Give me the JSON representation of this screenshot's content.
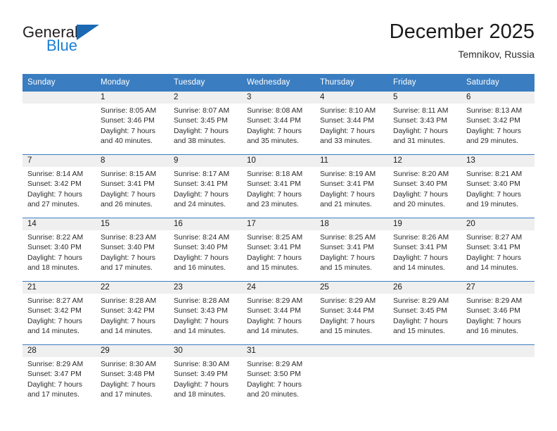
{
  "brand": {
    "name_top": "General",
    "name_bottom": "Blue",
    "triangle_color": "#1b68b3",
    "blue_text_color": "#1b7fd4"
  },
  "header": {
    "title": "December 2025",
    "subtitle": "Temnikov, Russia"
  },
  "colors": {
    "header_blue": "#3a7dc0",
    "daynum_band": "#efefef",
    "text": "#2b2b2b"
  },
  "weekdays": [
    "Sunday",
    "Monday",
    "Tuesday",
    "Wednesday",
    "Thursday",
    "Friday",
    "Saturday"
  ],
  "weeks": [
    [
      {
        "day": "",
        "sunrise": "",
        "sunset": "",
        "daylight1": "",
        "daylight2": ""
      },
      {
        "day": "1",
        "sunrise": "Sunrise: 8:05 AM",
        "sunset": "Sunset: 3:46 PM",
        "daylight1": "Daylight: 7 hours",
        "daylight2": "and 40 minutes."
      },
      {
        "day": "2",
        "sunrise": "Sunrise: 8:07 AM",
        "sunset": "Sunset: 3:45 PM",
        "daylight1": "Daylight: 7 hours",
        "daylight2": "and 38 minutes."
      },
      {
        "day": "3",
        "sunrise": "Sunrise: 8:08 AM",
        "sunset": "Sunset: 3:44 PM",
        "daylight1": "Daylight: 7 hours",
        "daylight2": "and 35 minutes."
      },
      {
        "day": "4",
        "sunrise": "Sunrise: 8:10 AM",
        "sunset": "Sunset: 3:44 PM",
        "daylight1": "Daylight: 7 hours",
        "daylight2": "and 33 minutes."
      },
      {
        "day": "5",
        "sunrise": "Sunrise: 8:11 AM",
        "sunset": "Sunset: 3:43 PM",
        "daylight1": "Daylight: 7 hours",
        "daylight2": "and 31 minutes."
      },
      {
        "day": "6",
        "sunrise": "Sunrise: 8:13 AM",
        "sunset": "Sunset: 3:42 PM",
        "daylight1": "Daylight: 7 hours",
        "daylight2": "and 29 minutes."
      }
    ],
    [
      {
        "day": "7",
        "sunrise": "Sunrise: 8:14 AM",
        "sunset": "Sunset: 3:42 PM",
        "daylight1": "Daylight: 7 hours",
        "daylight2": "and 27 minutes."
      },
      {
        "day": "8",
        "sunrise": "Sunrise: 8:15 AM",
        "sunset": "Sunset: 3:41 PM",
        "daylight1": "Daylight: 7 hours",
        "daylight2": "and 26 minutes."
      },
      {
        "day": "9",
        "sunrise": "Sunrise: 8:17 AM",
        "sunset": "Sunset: 3:41 PM",
        "daylight1": "Daylight: 7 hours",
        "daylight2": "and 24 minutes."
      },
      {
        "day": "10",
        "sunrise": "Sunrise: 8:18 AM",
        "sunset": "Sunset: 3:41 PM",
        "daylight1": "Daylight: 7 hours",
        "daylight2": "and 23 minutes."
      },
      {
        "day": "11",
        "sunrise": "Sunrise: 8:19 AM",
        "sunset": "Sunset: 3:41 PM",
        "daylight1": "Daylight: 7 hours",
        "daylight2": "and 21 minutes."
      },
      {
        "day": "12",
        "sunrise": "Sunrise: 8:20 AM",
        "sunset": "Sunset: 3:40 PM",
        "daylight1": "Daylight: 7 hours",
        "daylight2": "and 20 minutes."
      },
      {
        "day": "13",
        "sunrise": "Sunrise: 8:21 AM",
        "sunset": "Sunset: 3:40 PM",
        "daylight1": "Daylight: 7 hours",
        "daylight2": "and 19 minutes."
      }
    ],
    [
      {
        "day": "14",
        "sunrise": "Sunrise: 8:22 AM",
        "sunset": "Sunset: 3:40 PM",
        "daylight1": "Daylight: 7 hours",
        "daylight2": "and 18 minutes."
      },
      {
        "day": "15",
        "sunrise": "Sunrise: 8:23 AM",
        "sunset": "Sunset: 3:40 PM",
        "daylight1": "Daylight: 7 hours",
        "daylight2": "and 17 minutes."
      },
      {
        "day": "16",
        "sunrise": "Sunrise: 8:24 AM",
        "sunset": "Sunset: 3:40 PM",
        "daylight1": "Daylight: 7 hours",
        "daylight2": "and 16 minutes."
      },
      {
        "day": "17",
        "sunrise": "Sunrise: 8:25 AM",
        "sunset": "Sunset: 3:41 PM",
        "daylight1": "Daylight: 7 hours",
        "daylight2": "and 15 minutes."
      },
      {
        "day": "18",
        "sunrise": "Sunrise: 8:25 AM",
        "sunset": "Sunset: 3:41 PM",
        "daylight1": "Daylight: 7 hours",
        "daylight2": "and 15 minutes."
      },
      {
        "day": "19",
        "sunrise": "Sunrise: 8:26 AM",
        "sunset": "Sunset: 3:41 PM",
        "daylight1": "Daylight: 7 hours",
        "daylight2": "and 14 minutes."
      },
      {
        "day": "20",
        "sunrise": "Sunrise: 8:27 AM",
        "sunset": "Sunset: 3:41 PM",
        "daylight1": "Daylight: 7 hours",
        "daylight2": "and 14 minutes."
      }
    ],
    [
      {
        "day": "21",
        "sunrise": "Sunrise: 8:27 AM",
        "sunset": "Sunset: 3:42 PM",
        "daylight1": "Daylight: 7 hours",
        "daylight2": "and 14 minutes."
      },
      {
        "day": "22",
        "sunrise": "Sunrise: 8:28 AM",
        "sunset": "Sunset: 3:42 PM",
        "daylight1": "Daylight: 7 hours",
        "daylight2": "and 14 minutes."
      },
      {
        "day": "23",
        "sunrise": "Sunrise: 8:28 AM",
        "sunset": "Sunset: 3:43 PM",
        "daylight1": "Daylight: 7 hours",
        "daylight2": "and 14 minutes."
      },
      {
        "day": "24",
        "sunrise": "Sunrise: 8:29 AM",
        "sunset": "Sunset: 3:44 PM",
        "daylight1": "Daylight: 7 hours",
        "daylight2": "and 14 minutes."
      },
      {
        "day": "25",
        "sunrise": "Sunrise: 8:29 AM",
        "sunset": "Sunset: 3:44 PM",
        "daylight1": "Daylight: 7 hours",
        "daylight2": "and 15 minutes."
      },
      {
        "day": "26",
        "sunrise": "Sunrise: 8:29 AM",
        "sunset": "Sunset: 3:45 PM",
        "daylight1": "Daylight: 7 hours",
        "daylight2": "and 15 minutes."
      },
      {
        "day": "27",
        "sunrise": "Sunrise: 8:29 AM",
        "sunset": "Sunset: 3:46 PM",
        "daylight1": "Daylight: 7 hours",
        "daylight2": "and 16 minutes."
      }
    ],
    [
      {
        "day": "28",
        "sunrise": "Sunrise: 8:29 AM",
        "sunset": "Sunset: 3:47 PM",
        "daylight1": "Daylight: 7 hours",
        "daylight2": "and 17 minutes."
      },
      {
        "day": "29",
        "sunrise": "Sunrise: 8:30 AM",
        "sunset": "Sunset: 3:48 PM",
        "daylight1": "Daylight: 7 hours",
        "daylight2": "and 17 minutes."
      },
      {
        "day": "30",
        "sunrise": "Sunrise: 8:30 AM",
        "sunset": "Sunset: 3:49 PM",
        "daylight1": "Daylight: 7 hours",
        "daylight2": "and 18 minutes."
      },
      {
        "day": "31",
        "sunrise": "Sunrise: 8:29 AM",
        "sunset": "Sunset: 3:50 PM",
        "daylight1": "Daylight: 7 hours",
        "daylight2": "and 20 minutes."
      },
      {
        "day": "",
        "sunrise": "",
        "sunset": "",
        "daylight1": "",
        "daylight2": ""
      },
      {
        "day": "",
        "sunrise": "",
        "sunset": "",
        "daylight1": "",
        "daylight2": ""
      },
      {
        "day": "",
        "sunrise": "",
        "sunset": "",
        "daylight1": "",
        "daylight2": ""
      }
    ]
  ]
}
